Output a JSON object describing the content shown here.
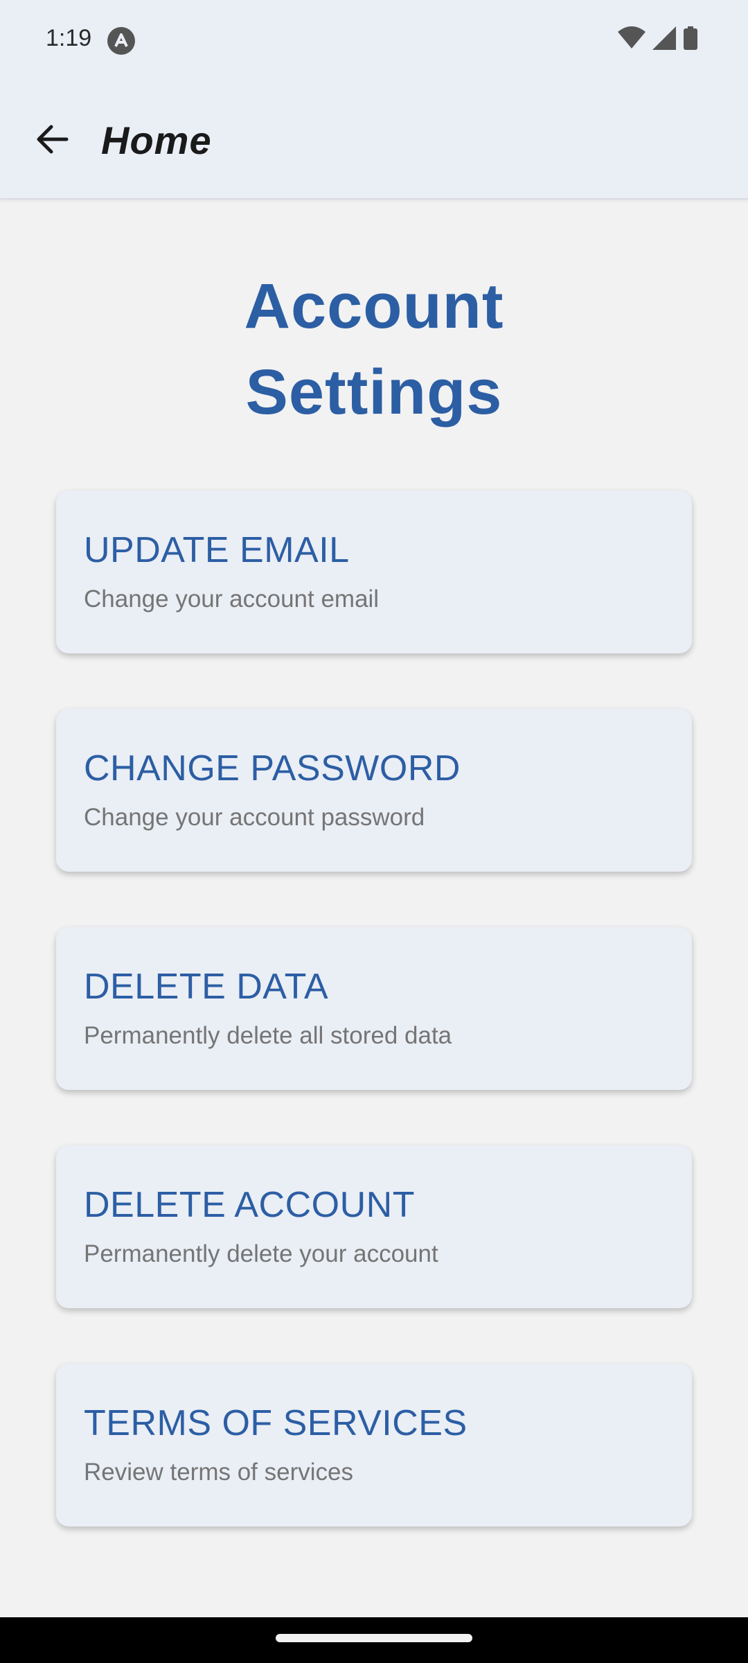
{
  "status_bar": {
    "time": "1:19",
    "icons": [
      "app-notification-icon",
      "wifi-icon",
      "cellular-signal-icon",
      "battery-icon"
    ]
  },
  "app_bar": {
    "back_icon": "arrow-left-icon",
    "title": "Home"
  },
  "page": {
    "title_line1": "Account",
    "title_line2": "Settings"
  },
  "cards": [
    {
      "title": "UPDATE EMAIL",
      "subtitle": "Change your account email"
    },
    {
      "title": "CHANGE PASSWORD",
      "subtitle": "Change your account password"
    },
    {
      "title": "DELETE DATA",
      "subtitle": "Permanently delete all stored data"
    },
    {
      "title": "DELETE ACCOUNT",
      "subtitle": "Permanently delete your account"
    },
    {
      "title": "TERMS OF SERVICES",
      "subtitle": "Review terms of services"
    }
  ],
  "colors": {
    "accent": "#2c5ea4",
    "card_background": "#eaeef5",
    "page_background": "#f2f2f2",
    "subtitle_text": "#757575"
  }
}
